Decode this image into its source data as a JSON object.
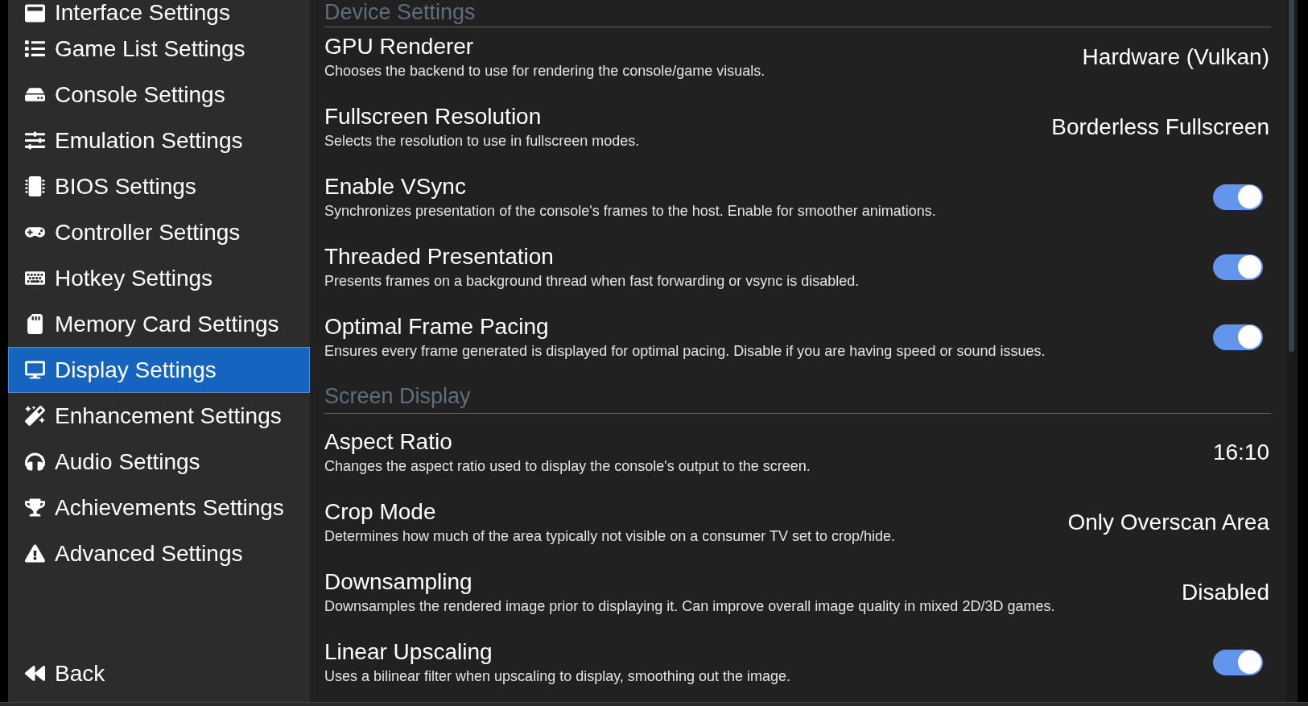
{
  "sidebar": {
    "items": [
      {
        "label": "Interface Settings",
        "selected": false
      },
      {
        "label": "Game List Settings",
        "selected": false
      },
      {
        "label": "Console Settings",
        "selected": false
      },
      {
        "label": "Emulation Settings",
        "selected": false
      },
      {
        "label": "BIOS Settings",
        "selected": false
      },
      {
        "label": "Controller Settings",
        "selected": false
      },
      {
        "label": "Hotkey Settings",
        "selected": false
      },
      {
        "label": "Memory Card Settings",
        "selected": false
      },
      {
        "label": "Display Settings",
        "selected": true
      },
      {
        "label": "Enhancement Settings",
        "selected": false
      },
      {
        "label": "Audio Settings",
        "selected": false
      },
      {
        "label": "Achievements Settings",
        "selected": false
      },
      {
        "label": "Advanced Settings",
        "selected": false
      }
    ],
    "back_button": {
      "label": "Back"
    }
  },
  "sections": [
    {
      "title": "Device Settings",
      "settings": [
        {
          "kind": "choice",
          "title": "GPU Renderer",
          "description": "Chooses the backend to use for rendering the console/game visuals.",
          "value": "Hardware (Vulkan)"
        },
        {
          "kind": "choice",
          "title": "Fullscreen Resolution",
          "description": "Selects the resolution to use in fullscreen modes.",
          "value": "Borderless Fullscreen"
        },
        {
          "kind": "toggle",
          "title": "Enable VSync",
          "description": "Synchronizes presentation of the console's frames to the host. Enable for smoother animations.",
          "on": true
        },
        {
          "kind": "toggle",
          "title": "Threaded Presentation",
          "description": "Presents frames on a background thread when fast forwarding or vsync is disabled.",
          "on": true
        },
        {
          "kind": "toggle",
          "title": "Optimal Frame Pacing",
          "description": "Ensures every frame generated is displayed for optimal pacing. Disable if you are having speed or sound issues.",
          "on": true
        }
      ]
    },
    {
      "title": "Screen Display",
      "settings": [
        {
          "kind": "choice",
          "title": "Aspect Ratio",
          "description": "Changes the aspect ratio used to display the console's output to the screen.",
          "value": "16:10"
        },
        {
          "kind": "choice",
          "title": "Crop Mode",
          "description": "Determines how much of the area typically not visible on a consumer TV set to crop/hide.",
          "value": "Only Overscan Area"
        },
        {
          "kind": "choice",
          "title": "Downsampling",
          "description": "Downsamples the rendered image prior to displaying it. Can improve overall image quality in mixed 2D/3D games.",
          "value": "Disabled"
        },
        {
          "kind": "toggle",
          "title": "Linear Upscaling",
          "description": "Uses a bilinear filter when upscaling to display, smoothing out the image.",
          "on": true
        }
      ]
    }
  ]
}
